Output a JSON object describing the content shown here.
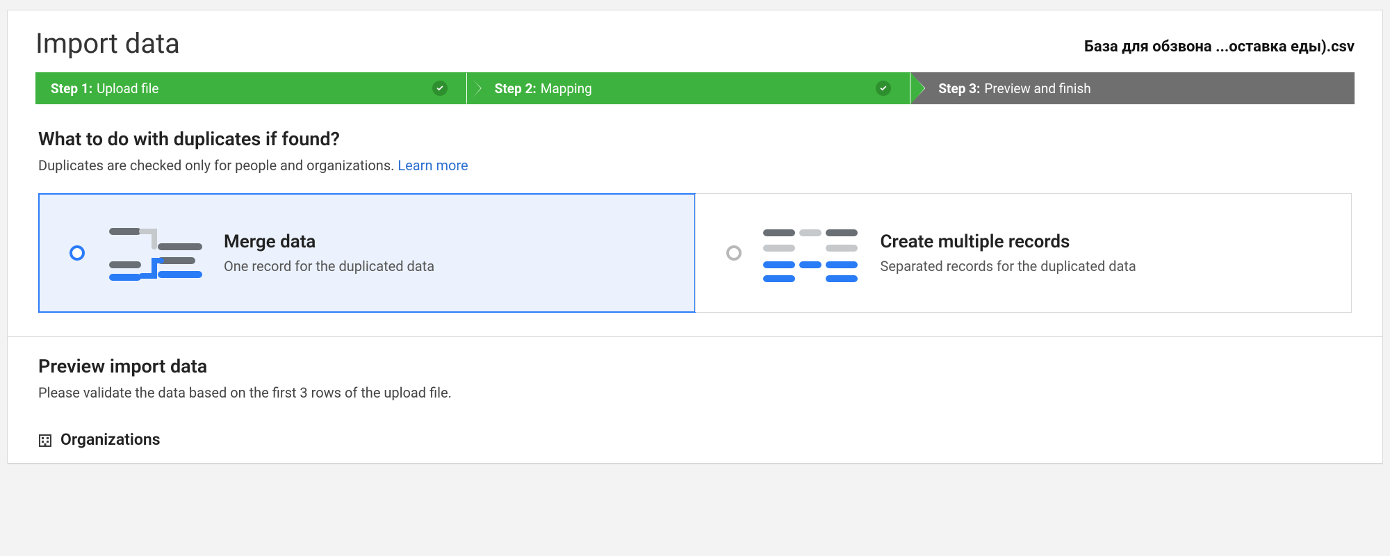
{
  "header": {
    "title": "Import data",
    "file_name": "База для обзвона ...оставка еды).csv"
  },
  "steps": [
    {
      "bold": "Step 1:",
      "rest": "Upload file",
      "state": "done",
      "show_check": true
    },
    {
      "bold": "Step 2:",
      "rest": "Mapping",
      "state": "done",
      "show_check": true
    },
    {
      "bold": "Step 3:",
      "rest": "Preview and finish",
      "state": "current",
      "show_check": false
    }
  ],
  "duplicates": {
    "question": "What to do with duplicates if found?",
    "subtext": "Duplicates are checked only for people and organizations. ",
    "learn_more": "Learn more",
    "options": [
      {
        "title": "Merge data",
        "desc": "One record for the duplicated data",
        "selected": true
      },
      {
        "title": "Create multiple records",
        "desc": "Separated records for the duplicated data",
        "selected": false
      }
    ]
  },
  "preview": {
    "title": "Preview import data",
    "subtext": "Please validate the data based on the first 3 rows of the upload file.",
    "org_label": "Organizations"
  }
}
